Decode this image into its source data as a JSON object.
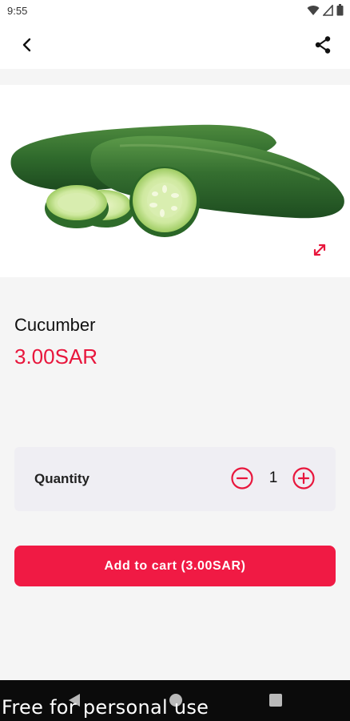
{
  "status_bar": {
    "time": "9:55"
  },
  "product": {
    "name": "Cucumber",
    "price": "3.00SAR"
  },
  "quantity": {
    "label": "Quantity",
    "value": "1"
  },
  "cart": {
    "add_label": "Add to cart (3.00SAR)"
  },
  "watermark": "Free for personal use",
  "icons": {
    "back": "back-arrow-icon",
    "share": "share-icon",
    "expand": "expand-icon",
    "minus": "minus-circle-icon",
    "plus": "plus-circle-icon",
    "wifi": "wifi-icon",
    "signal": "signal-icon",
    "battery": "battery-icon"
  },
  "colors": {
    "accent": "#e8163c",
    "button": "#f01a44",
    "card": "#efeef3"
  }
}
